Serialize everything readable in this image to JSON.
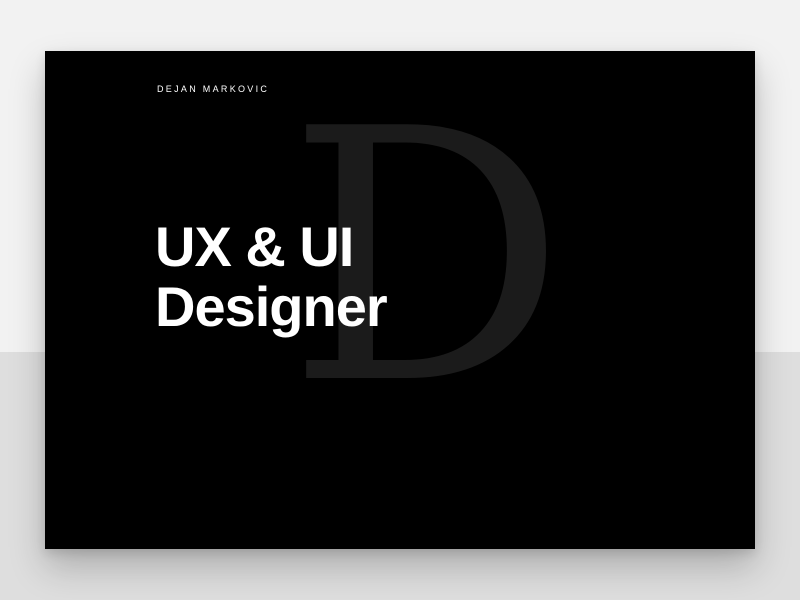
{
  "author": {
    "name": "DEJAN MARKOVIC"
  },
  "hero": {
    "monogram": "D",
    "headline_line1": "UX & UI",
    "headline_line2": "Designer"
  },
  "colors": {
    "background": "#f2f2f2",
    "background_lower": "#dedede",
    "card": "#000000",
    "text": "#ffffff",
    "monogram": "#1b1b1b"
  }
}
